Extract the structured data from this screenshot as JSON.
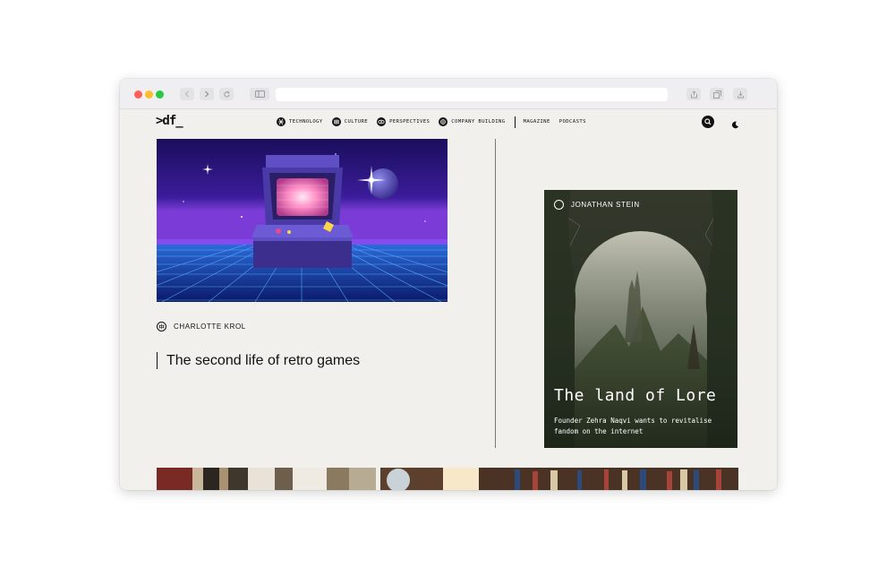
{
  "browser": {
    "traffic_lights": [
      "#fe5f57",
      "#febc2e",
      "#28c840"
    ],
    "url": ""
  },
  "site": {
    "logo": ">df_",
    "nav": [
      {
        "label": "TECHNOLOGY",
        "icon": "technology-icon"
      },
      {
        "label": "CULTURE",
        "icon": "culture-icon"
      },
      {
        "label": "PERSPECTIVES",
        "icon": "perspectives-icon"
      },
      {
        "label": "COMPANY BUILDING",
        "icon": "company-building-icon"
      }
    ],
    "nav_links": [
      "MAGAZINE",
      "PODCASTS"
    ],
    "search_icon": "search-icon",
    "theme_toggle_icon": "moon-icon"
  },
  "feature": {
    "image": "retro-arcade-machine-illustration",
    "author": "CHARLOTTE KROL",
    "headline": "The second life of retro games"
  },
  "card": {
    "image": "fantasy-landscape-map-illustration",
    "author": "JONATHAN STEIN",
    "title": "The land of Lore",
    "subtitle": "Founder Zehra Naqvi wants to revitalise fandom on the internet"
  },
  "colors": {
    "page_bg": "#f2f0ec",
    "text": "#111111",
    "accent_purple": "#5b2bb5"
  }
}
